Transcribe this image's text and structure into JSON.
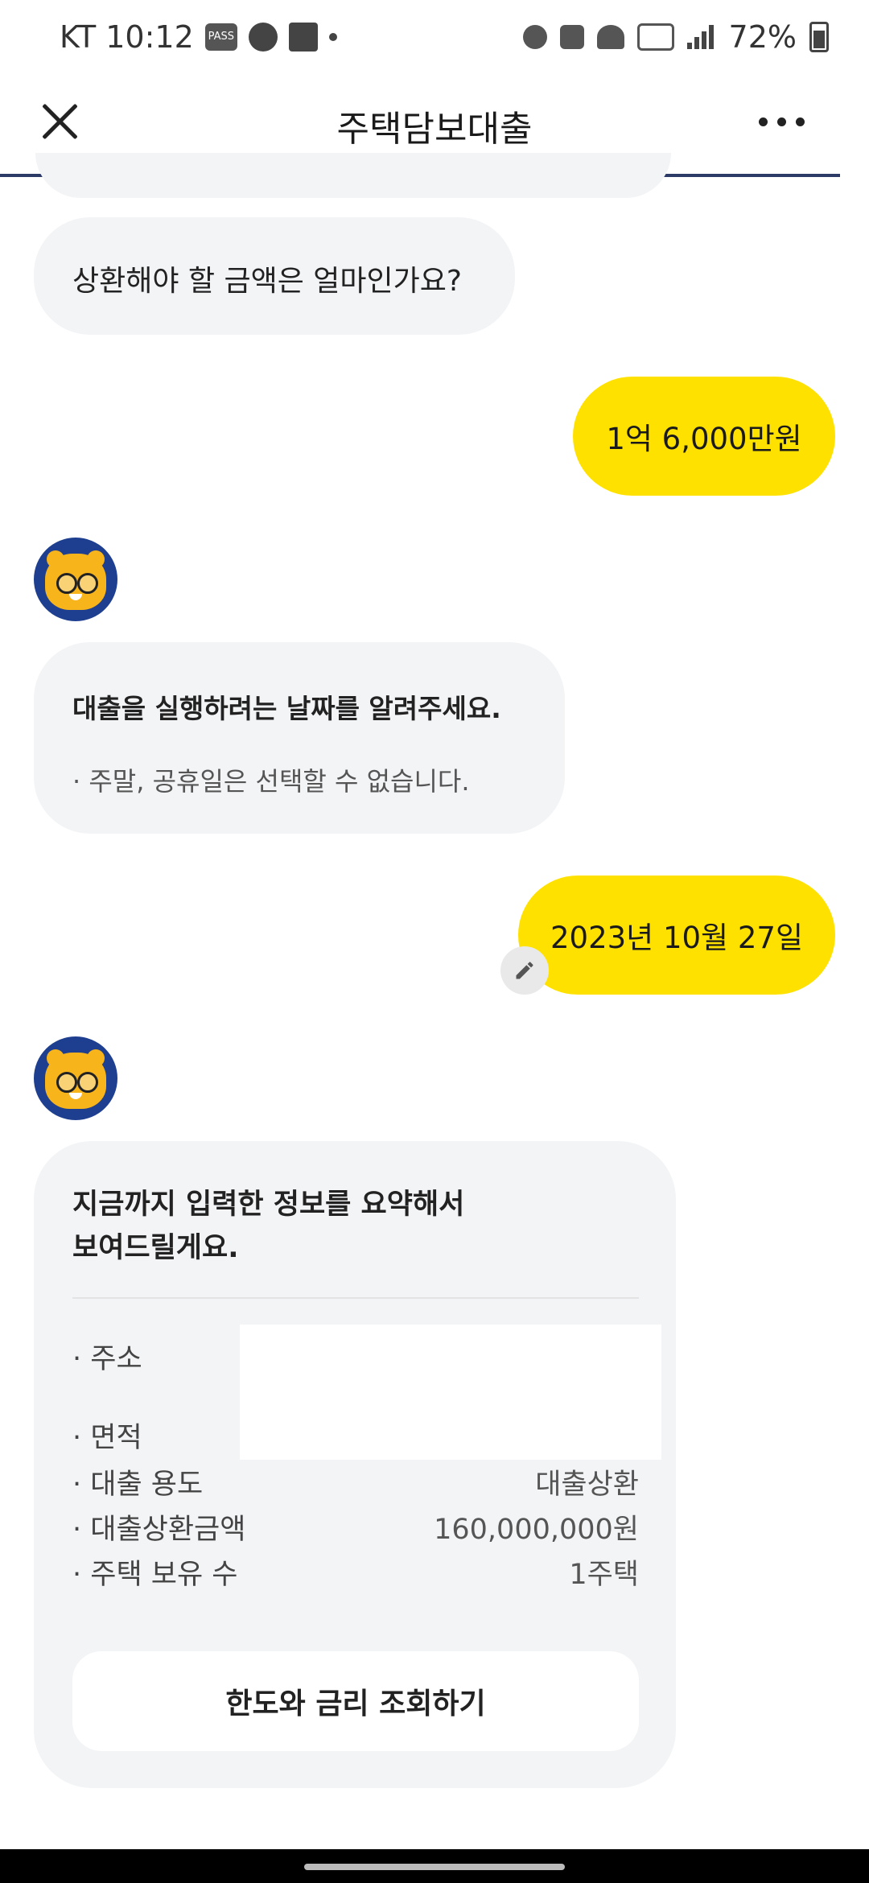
{
  "status_bar": {
    "carrier_time": "KT 10:12",
    "pass_label": "PASS",
    "battery": "72%"
  },
  "header": {
    "title": "주택담보대출"
  },
  "chat": {
    "bot_question_repay": "상환해야 할 금액은 얼마인가요?",
    "user_answer_amount": "1억 6,000만원",
    "bot_question_date_title": "대출을 실행하려는 날짜를 알려주세요.",
    "bot_question_date_note": "· 주말, 공휴일은 선택할 수 없습니다.",
    "user_answer_date": "2023년 10월 27일",
    "summary": {
      "title_line1": "지금까지 입력한 정보를 요약해서",
      "title_line2": "보여드릴게요.",
      "rows": [
        {
          "label": "· 주소",
          "value": ""
        },
        {
          "label": "· 면적",
          "value": ""
        },
        {
          "label": "· 대출 용도",
          "value": "대출상환"
        },
        {
          "label": "· 대출상환금액",
          "value": "160,000,000원"
        },
        {
          "label": "· 주택 보유 수",
          "value": "1주택"
        }
      ],
      "cta_label": "한도와 금리 조회하기"
    }
  },
  "icons": {
    "close": "close-icon",
    "more": "more-icon",
    "edit": "pencil-icon",
    "avatar": "mascot-avatar"
  },
  "colors": {
    "user_bubble": "#ffe100",
    "bot_bubble": "#f3f4f6",
    "header_rule": "#2b3a67",
    "avatar_bg": "#1e3f8f"
  }
}
